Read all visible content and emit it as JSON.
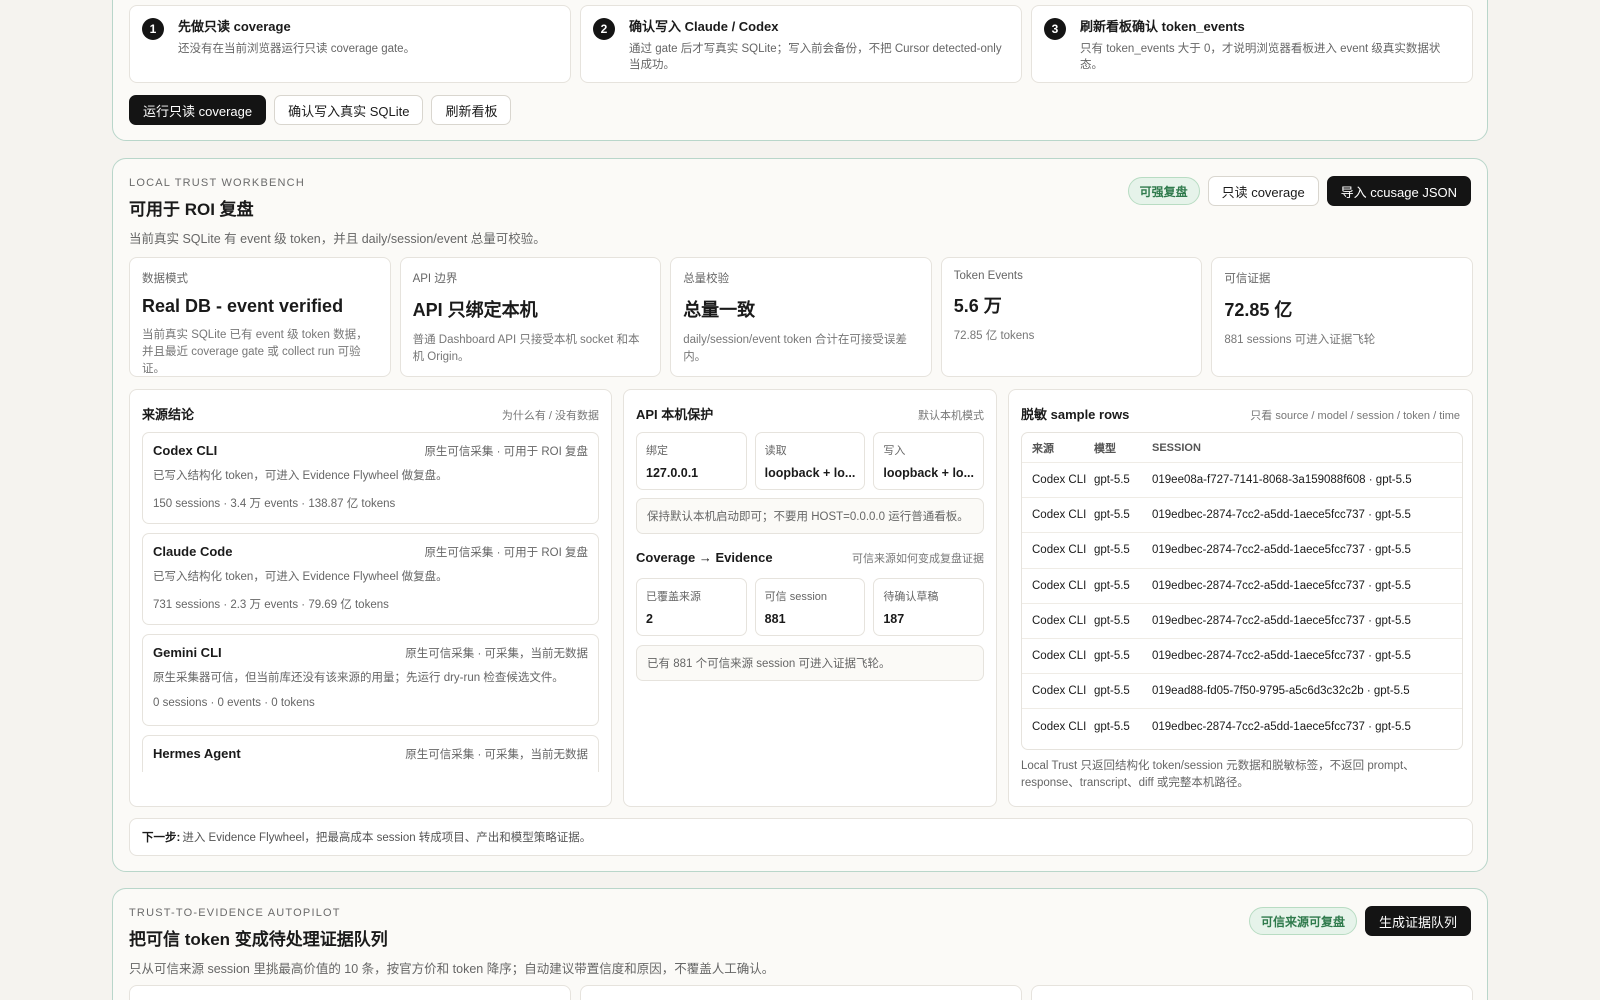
{
  "gate": {
    "steps": [
      {
        "num": "1",
        "title": "先做只读 coverage",
        "desc": "还没有在当前浏览器运行只读 coverage gate。"
      },
      {
        "num": "2",
        "title": "确认写入 Claude / Codex",
        "desc": "通过 gate 后才写真实 SQLite；写入前会备份，不把 Cursor detected-only 当成功。"
      },
      {
        "num": "3",
        "title": "刷新看板确认 token_events",
        "desc": "只有 token_events 大于 0，才说明浏览器看板进入 event 级真实数据状态。"
      }
    ],
    "buttons": {
      "run": "运行只读 coverage",
      "write": "确认写入真实 SQLite",
      "refresh": "刷新看板"
    }
  },
  "workbench": {
    "kicker": "LOCAL TRUST WORKBENCH",
    "title": "可用于 ROI 复盘",
    "subtitle": "当前真实 SQLite 有 event 级 token，并且 daily/session/event 总量可校验。",
    "badge": "可强复盘",
    "btn_coverage": "只读 coverage",
    "btn_import": "导入 ccusage JSON",
    "metrics": [
      {
        "label": "数据模式",
        "value": "Real DB - event verified",
        "note": "当前真实 SQLite 已有 event 级 token 数据，并且最近 coverage gate 或 collect run 可验证。"
      },
      {
        "label": "API 边界",
        "value": "API 只绑定本机",
        "note": "普通 Dashboard API 只接受本机 socket 和本机 Origin。"
      },
      {
        "label": "总量校验",
        "value": "总量一致",
        "note": "daily/session/event token 合计在可接受误差内。"
      },
      {
        "label": "Token Events",
        "value": "5.6 万",
        "note": "72.85 亿 tokens"
      },
      {
        "label": "可信证据",
        "value": "72.85 亿",
        "note": "881 sessions 可进入证据飞轮"
      }
    ],
    "sources": {
      "title": "来源结论",
      "hint": "为什么有 / 没有数据",
      "items": [
        {
          "name": "Codex CLI",
          "status": "原生可信采集 · 可用于 ROI 复盘",
          "desc": "已写入结构化 token，可进入 Evidence Flywheel 做复盘。",
          "stats": "150 sessions · 3.4 万 events · 138.87 亿 tokens"
        },
        {
          "name": "Claude Code",
          "status": "原生可信采集 · 可用于 ROI 复盘",
          "desc": "已写入结构化 token，可进入 Evidence Flywheel 做复盘。",
          "stats": "731 sessions · 2.3 万 events · 79.69 亿 tokens"
        },
        {
          "name": "Gemini CLI",
          "status": "原生可信采集 · 可采集，当前无数据",
          "desc": "原生采集器可信，但当前库还没有该来源的用量；先运行 dry-run 检查候选文件。",
          "stats": "0 sessions · 0 events · 0 tokens"
        },
        {
          "name": "Hermes Agent",
          "status": "原生可信采集 · 可采集，当前无数据",
          "desc": "",
          "stats": ""
        }
      ]
    },
    "api": {
      "title": "API 本机保护",
      "hint": "默认本机模式",
      "cells": [
        {
          "label": "绑定",
          "value": "127.0.0.1"
        },
        {
          "label": "读取",
          "value": "loopback + lo..."
        },
        {
          "label": "写入",
          "value": "loopback + lo..."
        }
      ],
      "note": "保持默认本机启动即可；不要用 HOST=0.0.0.0 运行普通看板。",
      "coverage_title": "Coverage → Evidence",
      "coverage_hint": "可信来源如何变成复盘证据",
      "coverage_cells": [
        {
          "label": "已覆盖来源",
          "value": "2"
        },
        {
          "label": "可信 session",
          "value": "881"
        },
        {
          "label": "待确认草稿",
          "value": "187"
        }
      ],
      "coverage_note": "已有 881 个可信来源 session 可进入证据飞轮。"
    },
    "rows": {
      "title": "脱敏 sample rows",
      "hint": "只看 source / model / session / token / time",
      "headers": [
        "来源",
        "模型",
        "SESSION"
      ],
      "data": [
        [
          "Codex CLI",
          "gpt-5.5",
          "019ee08a-f727-7141-8068-3a159088f608 · gpt-5.5"
        ],
        [
          "Codex CLI",
          "gpt-5.5",
          "019edbec-2874-7cc2-a5dd-1aece5fcc737 · gpt-5.5"
        ],
        [
          "Codex CLI",
          "gpt-5.5",
          "019edbec-2874-7cc2-a5dd-1aece5fcc737 · gpt-5.5"
        ],
        [
          "Codex CLI",
          "gpt-5.5",
          "019edbec-2874-7cc2-a5dd-1aece5fcc737 · gpt-5.5"
        ],
        [
          "Codex CLI",
          "gpt-5.5",
          "019edbec-2874-7cc2-a5dd-1aece5fcc737 · gpt-5.5"
        ],
        [
          "Codex CLI",
          "gpt-5.5",
          "019edbec-2874-7cc2-a5dd-1aece5fcc737 · gpt-5.5"
        ],
        [
          "Codex CLI",
          "gpt-5.5",
          "019ead88-fd05-7f50-9795-a5c6d3c32c2b · gpt-5.5"
        ],
        [
          "Codex CLI",
          "gpt-5.5",
          "019edbec-2874-7cc2-a5dd-1aece5fcc737 · gpt-5.5"
        ]
      ],
      "footer": "Local Trust 只返回结构化 token/session 元数据和脱敏标签，不返回 prompt、response、transcript、diff 或完整本机路径。"
    },
    "next_step_label": "下一步:",
    "next_step_text": "进入 Evidence Flywheel，把最高成本 session 转成项目、产出和模型策略证据。"
  },
  "autopilot": {
    "kicker": "TRUST-TO-EVIDENCE AUTOPILOT",
    "title": "把可信 token 变成待处理证据队列",
    "subtitle": "只从可信来源 session 里挑最高价值的 10 条，按官方价和 token 降序；自动建议带置信度和原因，不覆盖人工确认。",
    "badge": "可信来源可复盘",
    "btn_generate": "生成证据队列"
  },
  "colors": {
    "accent_dark": "#141414",
    "card_border": "#b9d6ca",
    "badge_green": "#2f7a4c",
    "background": "#f5f3ef"
  }
}
